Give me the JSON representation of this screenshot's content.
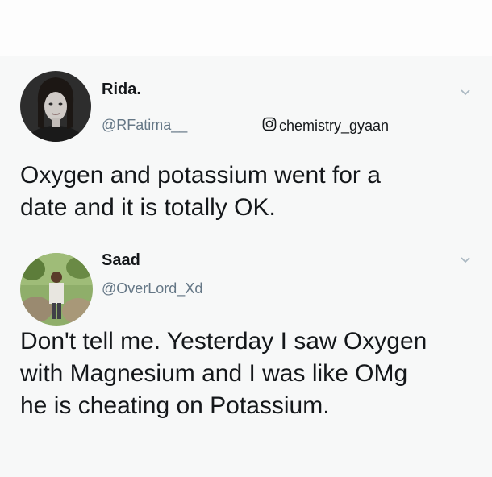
{
  "tweets": [
    {
      "name": "Rida.",
      "handle": "@RFatima__",
      "text": "Oxygen and potassium went for a\ndate and it is totally OK.",
      "avatar_icon": "woman-portrait-photo"
    },
    {
      "name": "Saad",
      "handle": "@OverLord_Xd",
      "text": "Don't tell me. Yesterday I saw Oxygen\nwith Magnesium and I was like OMg\nhe is cheating on Potassium.",
      "avatar_icon": "man-outdoor-photo"
    }
  ],
  "watermark": {
    "icon": "instagram-icon",
    "text": "chemistry_gyaan"
  },
  "colors": {
    "card_bg": "#f7f8f8",
    "text": "#14171a",
    "secondary_text": "#657786",
    "chevron": "#aab8c2"
  }
}
